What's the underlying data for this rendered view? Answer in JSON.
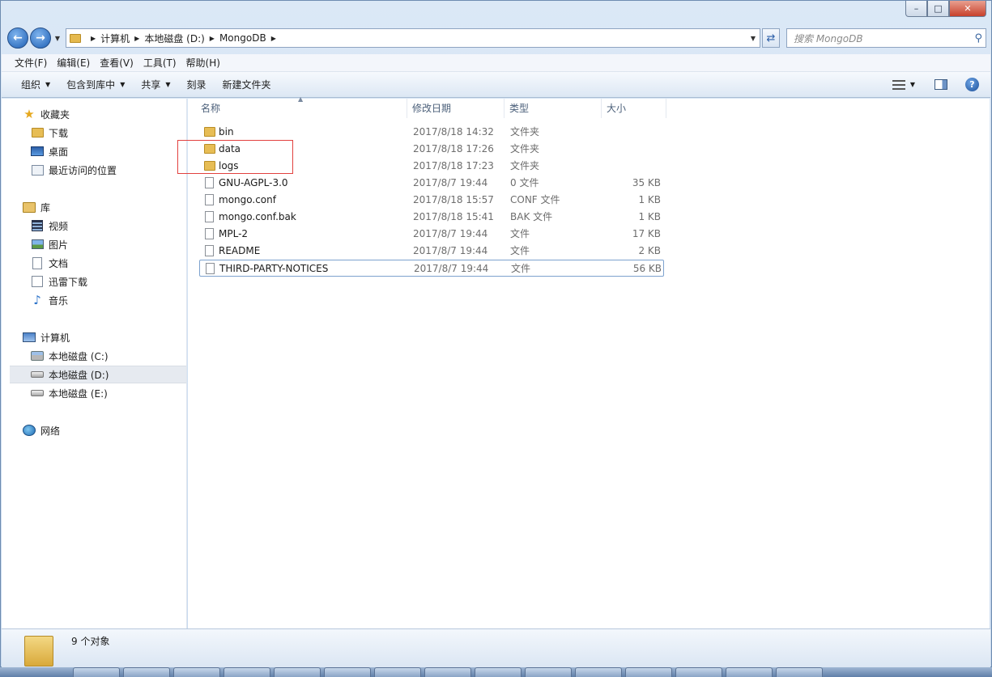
{
  "window": {
    "min_glyph": "–",
    "max_glyph": "□",
    "close_glyph": "✕"
  },
  "nav": {
    "back_glyph": "←",
    "forward_glyph": "→"
  },
  "address": {
    "crumbs": [
      "计算机",
      "本地磁盘 (D:)",
      "MongoDB"
    ],
    "search_placeholder": "搜索 MongoDB"
  },
  "menubar": [
    "文件(F)",
    "编辑(E)",
    "查看(V)",
    "工具(T)",
    "帮助(H)"
  ],
  "commandbar": [
    "组织",
    "包含到库中",
    "共享",
    "刻录",
    "新建文件夹"
  ],
  "help_glyph": "?",
  "navpane": {
    "favorites": {
      "label": "收藏夹",
      "items": [
        "下载",
        "桌面",
        "最近访问的位置"
      ]
    },
    "libraries": {
      "label": "库",
      "items": [
        "视频",
        "图片",
        "文档",
        "迅雷下载",
        "音乐"
      ]
    },
    "computer": {
      "label": "计算机",
      "items": [
        "本地磁盘 (C:)",
        "本地磁盘 (D:)",
        "本地磁盘 (E:)"
      ]
    },
    "network": {
      "label": "网络"
    }
  },
  "columns": {
    "name": "名称",
    "date": "修改日期",
    "type": "类型",
    "size": "大小"
  },
  "files": [
    {
      "name": "bin",
      "date": "2017/8/18 14:32",
      "type": "文件夹",
      "size": "",
      "icon": "folder"
    },
    {
      "name": "data",
      "date": "2017/8/18 17:26",
      "type": "文件夹",
      "size": "",
      "icon": "folder"
    },
    {
      "name": "logs",
      "date": "2017/8/18 17:23",
      "type": "文件夹",
      "size": "",
      "icon": "folder"
    },
    {
      "name": "GNU-AGPL-3.0",
      "date": "2017/8/7 19:44",
      "type": "0 文件",
      "size": "35 KB",
      "icon": "file"
    },
    {
      "name": "mongo.conf",
      "date": "2017/8/18 15:57",
      "type": "CONF 文件",
      "size": "1 KB",
      "icon": "file"
    },
    {
      "name": "mongo.conf.bak",
      "date": "2017/8/18 15:41",
      "type": "BAK 文件",
      "size": "1 KB",
      "icon": "file"
    },
    {
      "name": "MPL-2",
      "date": "2017/8/7 19:44",
      "type": "文件",
      "size": "17 KB",
      "icon": "file"
    },
    {
      "name": "README",
      "date": "2017/8/7 19:44",
      "type": "文件",
      "size": "2 KB",
      "icon": "file"
    },
    {
      "name": "THIRD-PARTY-NOTICES",
      "date": "2017/8/7 19:44",
      "type": "文件",
      "size": "56 KB",
      "icon": "file"
    }
  ],
  "details": {
    "count_text": "9 个对象"
  },
  "colors": {
    "highlight": "#e2413f",
    "accent": "#1d5fb4"
  }
}
